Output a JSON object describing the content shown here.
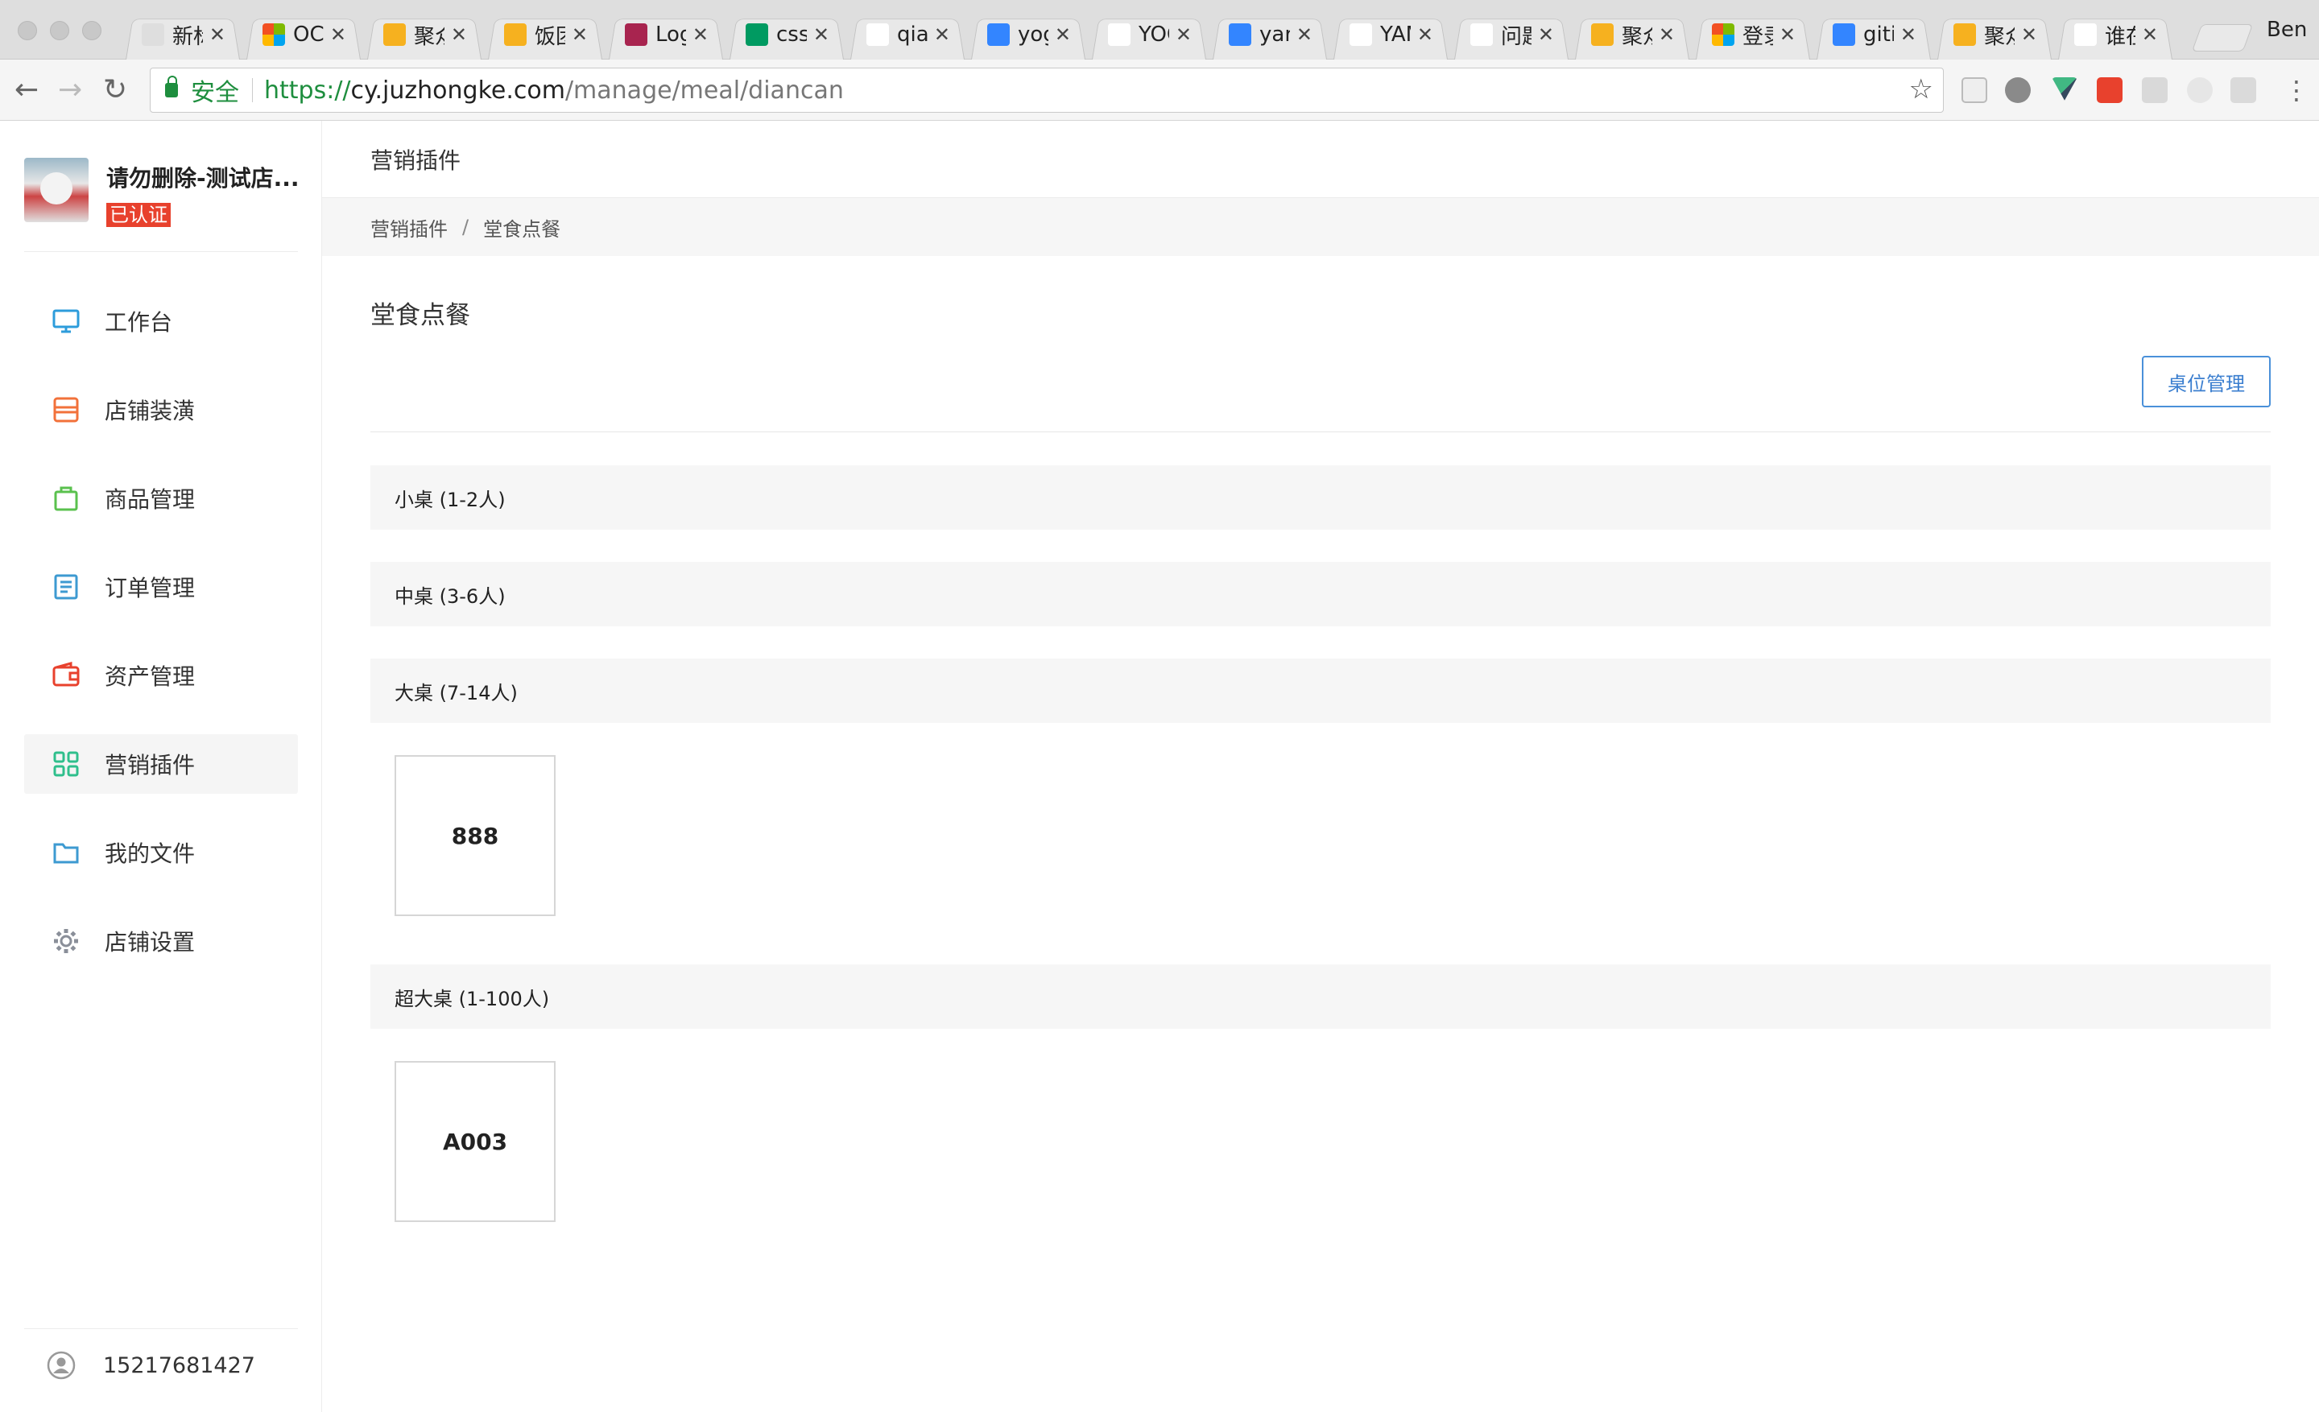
{
  "browser": {
    "tabs": [
      {
        "label": "新标签页",
        "icon": "blank-icon",
        "color": "#dedede"
      },
      {
        "label": "OCR",
        "icon": "microsoft-icon",
        "color": "#f25022"
      },
      {
        "label": "聚众",
        "icon": "jzk-icon",
        "color": "#f6b11f"
      },
      {
        "label": "饭团",
        "icon": "jzk-icon",
        "color": "#f6b11f"
      },
      {
        "label": "Log",
        "icon": "r-icon",
        "color": "#a8244f"
      },
      {
        "label": "css",
        "icon": "sf-icon",
        "color": "#009a61"
      },
      {
        "label": "qiar",
        "icon": "document-icon",
        "color": "#ffffff"
      },
      {
        "label": "yog",
        "icon": "baidu-icon",
        "color": "#3385ff"
      },
      {
        "label": "YOG",
        "icon": "fex-icon",
        "color": "#ffffff"
      },
      {
        "label": "yarr",
        "icon": "baidu-icon",
        "color": "#3385ff"
      },
      {
        "label": "YAM",
        "icon": "calligraphy-icon",
        "color": "#ffffff"
      },
      {
        "label": "问题",
        "icon": "gauge-icon",
        "color": "#ffffff"
      },
      {
        "label": "聚众",
        "icon": "jzk-icon",
        "color": "#f6b11f"
      },
      {
        "label": "登录",
        "icon": "microsoft-icon",
        "color": "#f25022"
      },
      {
        "label": "gitig",
        "icon": "baidu-icon",
        "color": "#3385ff"
      },
      {
        "label": "聚众",
        "icon": "jzk-icon",
        "color": "#f6b11f"
      },
      {
        "label": "谁在",
        "icon": "github-icon",
        "color": "#ffffff"
      }
    ],
    "profile": "Ben",
    "secure_label": "安全",
    "url_scheme": "https://",
    "url_host": "cy.juzhongke.com",
    "url_path": "/manage/meal/diancan"
  },
  "sidebar": {
    "shop_name": "请勿删除-测试店...",
    "badge": "已认证",
    "items": [
      {
        "label": "工作台",
        "icon": "monitor-icon",
        "color": "#2d9cdb",
        "active": false
      },
      {
        "label": "店铺装潢",
        "icon": "store-icon",
        "color": "#f2713a",
        "active": false
      },
      {
        "label": "商品管理",
        "icon": "bag-icon",
        "color": "#5ac14e",
        "active": false
      },
      {
        "label": "订单管理",
        "icon": "order-icon",
        "color": "#3d9ad1",
        "active": false
      },
      {
        "label": "资产管理",
        "icon": "wallet-icon",
        "color": "#e8412d",
        "active": false
      },
      {
        "label": "营销插件",
        "icon": "grid-icon",
        "color": "#2fbf8c",
        "active": true
      },
      {
        "label": "我的文件",
        "icon": "folder-icon",
        "color": "#3d9ad1",
        "active": false
      },
      {
        "label": "店铺设置",
        "icon": "gear-icon",
        "color": "#8a8f99",
        "active": false
      }
    ],
    "user_phone": "15217681427"
  },
  "page": {
    "header_title": "营销插件",
    "breadcrumb": [
      "营销插件",
      "堂食点餐"
    ],
    "section_title": "堂食点餐",
    "manage_button": "桌位管理",
    "groups": [
      {
        "label": "小桌 (1-2人)",
        "tables": []
      },
      {
        "label": "中桌 (3-6人)",
        "tables": []
      },
      {
        "label": "大桌 (7-14人)",
        "tables": [
          "888"
        ]
      },
      {
        "label": "超大桌 (1-100人)",
        "tables": [
          "A003"
        ]
      }
    ]
  }
}
